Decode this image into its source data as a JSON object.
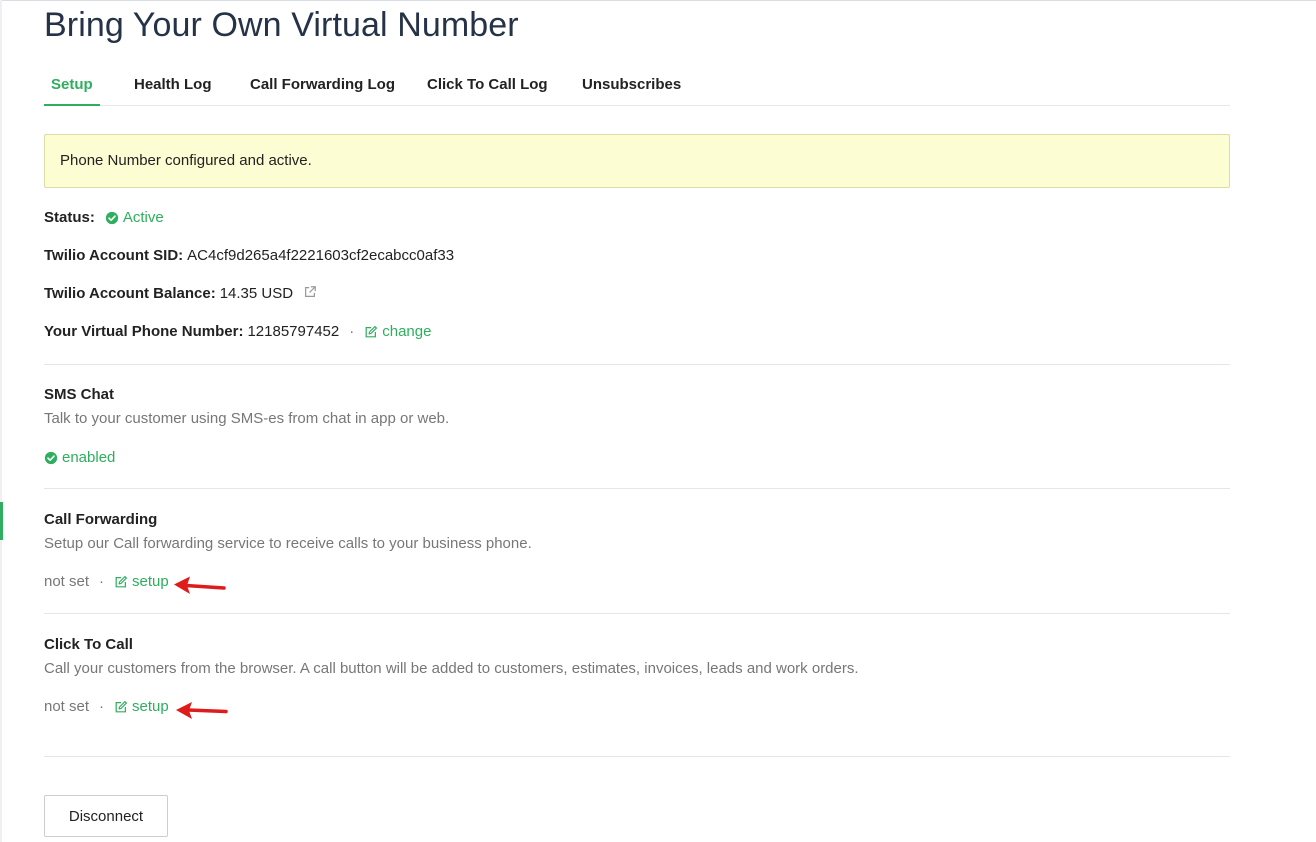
{
  "page": {
    "title": "Bring Your Own Virtual Number"
  },
  "tabs": [
    {
      "label": "Setup",
      "active": true
    },
    {
      "label": "Health Log"
    },
    {
      "label": "Call Forwarding Log"
    },
    {
      "label": "Click To Call Log"
    },
    {
      "label": "Unsubscribes"
    }
  ],
  "alert": {
    "text": "Phone Number configured and active."
  },
  "status": {
    "label": "Status:",
    "value": "Active",
    "icon": "check-circle-icon"
  },
  "account_sid": {
    "label": "Twilio Account SID:",
    "value": "AC4cf9d265a4f2221603cf2ecabcc0af33"
  },
  "account_balance": {
    "label": "Twilio Account Balance:",
    "value": "14.35 USD",
    "icon": "external-link-icon"
  },
  "virtual_number": {
    "label": "Your Virtual Phone Number:",
    "value": "12185797452",
    "action": "change",
    "icon": "edit-icon"
  },
  "sections": {
    "sms_chat": {
      "title": "SMS Chat",
      "description": "Talk to your customer using SMS-es from chat in app or web.",
      "state": "enabled",
      "icon": "check-circle-icon"
    },
    "call_forwarding": {
      "title": "Call Forwarding",
      "description": "Setup our Call forwarding service to receive calls to your business phone.",
      "state": "not set",
      "action": "setup",
      "icon": "edit-icon"
    },
    "click_to_call": {
      "title": "Click To Call",
      "description": "Call your customers from the browser. A call button will be added to customers, estimates, invoices, leads and work orders.",
      "state": "not set",
      "action": "setup",
      "icon": "edit-icon"
    }
  },
  "disconnect_button": {
    "label": "Disconnect"
  },
  "colors": {
    "accent": "#2eae5e",
    "alert_bg": "#fdfdd4",
    "annotation_arrow": "#e01b1b",
    "title": "#263247"
  }
}
